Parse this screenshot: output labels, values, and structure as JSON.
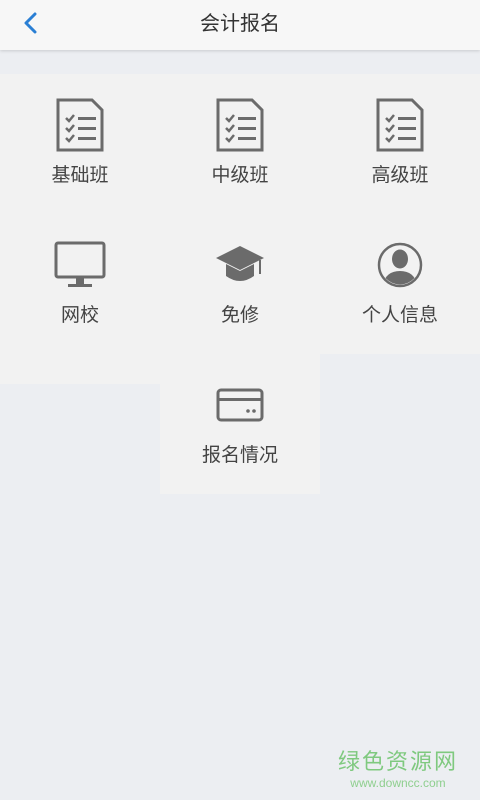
{
  "header": {
    "title": "会计报名",
    "back_icon": "chevron-left-icon"
  },
  "colors": {
    "accent": "#2a7fd4",
    "icon": "#6b6b6b",
    "tile_bg": "#f2f2f2",
    "page_bg": "#eceef2"
  },
  "grid": {
    "items": [
      {
        "label": "基础班",
        "icon": "document-checklist-icon"
      },
      {
        "label": "中级班",
        "icon": "document-checklist-icon"
      },
      {
        "label": "高级班",
        "icon": "document-checklist-icon"
      },
      {
        "label": "网校",
        "icon": "monitor-icon"
      },
      {
        "label": "免修",
        "icon": "graduation-cap-icon"
      },
      {
        "label": "个人信息",
        "icon": "user-avatar-icon"
      },
      {
        "label": "报名情况",
        "icon": "card-icon"
      }
    ]
  },
  "watermark": {
    "main": "绿色资源网",
    "sub": "www.downcc.com"
  }
}
